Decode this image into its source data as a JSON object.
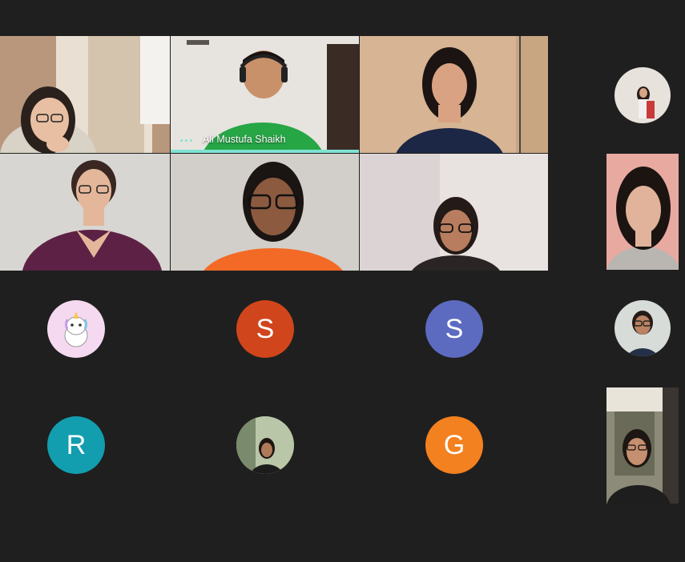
{
  "main_grid": {
    "tiles": [
      {
        "id": "t1",
        "shirt": "#d9d2c6",
        "bg": "#c6a48a"
      },
      {
        "id": "t2",
        "label": "Ali Mustufa Shaikh",
        "shirt": "#27a646",
        "bg": "#e7e4df",
        "active": true
      },
      {
        "id": "t3",
        "shirt": "#1b2744",
        "bg": "#d6b494"
      },
      {
        "id": "t4",
        "shirt": "#5d2145",
        "bg": "#d8d6d2"
      },
      {
        "id": "t5",
        "shirt": "#f26a25",
        "bg": "#d2cfca"
      },
      {
        "id": "t6",
        "shirt": "#2a2424",
        "bg": "#dcd4d4"
      }
    ]
  },
  "participants": [
    {
      "type": "image",
      "icon": "unicorn-avatar-icon",
      "color": "#f5d9f0"
    },
    {
      "type": "initial",
      "initial": "S",
      "color": "#d0451b"
    },
    {
      "type": "initial",
      "initial": "S",
      "color": "#5c6bc0"
    },
    {
      "type": "initial",
      "initial": "R",
      "color": "#129eaf"
    },
    {
      "type": "image",
      "icon": "profile-photo",
      "color": "#7b8c6a"
    },
    {
      "type": "initial",
      "initial": "G",
      "color": "#f4811f"
    }
  ],
  "sidebar": {
    "thumbs": [
      {
        "kind": "circle-photo",
        "color": "#e8e2dc"
      },
      {
        "kind": "video",
        "color": "#e8a9a1"
      },
      {
        "kind": "circle-photo",
        "color": "#d8dcd8"
      },
      {
        "kind": "video",
        "color": "#8c8a78"
      }
    ]
  }
}
